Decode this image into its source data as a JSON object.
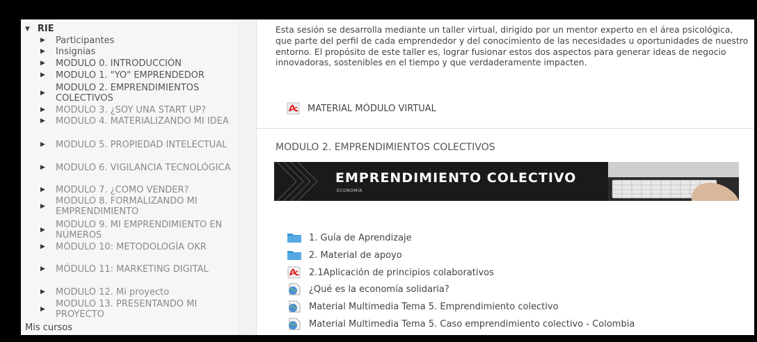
{
  "sidebar": {
    "root_label": "RIE",
    "items": [
      {
        "label": "Participantes",
        "tone": "dark"
      },
      {
        "label": "Insignias",
        "tone": "dark"
      },
      {
        "label": "MODULO 0. INTRODUCCIÓN",
        "tone": "dark"
      },
      {
        "label": "MODULO 1. \"YO\" EMPRENDEDOR",
        "tone": "dark"
      },
      {
        "label": "MODULO 2. EMPRENDIMIENTOS COLECTIVOS",
        "tone": "dark"
      },
      {
        "label": "MODULO 3. ¿SOY UNA START UP?",
        "tone": "gray"
      },
      {
        "label": "MODULO 4. MATERIALIZANDO MI IDEA",
        "tone": "gray"
      },
      {
        "label": "MODULO 5. PROPIEDAD INTELECTUAL",
        "tone": "gray"
      },
      {
        "label": "MODULO 6. VIGILANCIA TECNOLÓGICA",
        "tone": "gray"
      },
      {
        "label": "MODULO 7. ¿COMO VENDER?",
        "tone": "gray"
      },
      {
        "label": "MODULO 8. FORMALIZANDO MI EMPRENDIMIENTO",
        "tone": "gray"
      },
      {
        "label": "MODULO 9. MI EMPRENDIMIENTO EN NÚMEROS",
        "tone": "gray"
      },
      {
        "label": "MÓDULO 10: METODOLOGÍA OKR",
        "tone": "gray"
      },
      {
        "label": "MÓDULO 11: MARKETING DIGITAL",
        "tone": "gray"
      },
      {
        "label": "MODULO 12. Mi proyecto",
        "tone": "gray"
      },
      {
        "label": "MODULO 13. PRESENTANDO MI PROYECTO",
        "tone": "gray"
      }
    ],
    "mis_cursos": "Mis cursos"
  },
  "main": {
    "intro": "Esta sesión se desarrolla mediante un taller virtual, dirigido por un mentor experto en el área psicológica, que parte del perfil de cada emprendedor y del conocimiento de las necesidades u oportunidades de nuestro entorno. El propósito de este taller es, lograr fusionar estos dos aspectos para generar ideas de negocio innovadoras, sostenibles en el tiempo y que verdaderamente impacten.",
    "material_modulo": "MATERIAL MÓDULO VIRTUAL",
    "section_title": "MODULO 2. EMPRENDIMIENTOS COLECTIVOS",
    "banner": {
      "title": "EMPRENDIMIENTO COLECTIVO",
      "subtitle": "ECONOMÍA"
    },
    "resources": [
      {
        "label": "1. Guía de Aprendizaje",
        "icon": "folder-icon"
      },
      {
        "label": "2. Material de apoyo",
        "icon": "folder-icon"
      },
      {
        "label": "2.1Aplicación de principios colaborativos",
        "icon": "pdf-icon"
      },
      {
        "label": "¿Qué es la economía solidaria?",
        "icon": "url-icon"
      },
      {
        "label": "Material Multimedia Tema 5. Emprendimiento colectivo",
        "icon": "url-icon"
      },
      {
        "label": "Material Multimedia Tema 5. Caso emprendimiento colectivo - Colombia",
        "icon": "url-icon"
      }
    ]
  },
  "colors": {
    "background": "#000000",
    "sidebar_bg": "#f6f6f6",
    "banner_bg": "#1a1a1a",
    "folder": "#3a95d4",
    "pdf": "#e02020"
  }
}
